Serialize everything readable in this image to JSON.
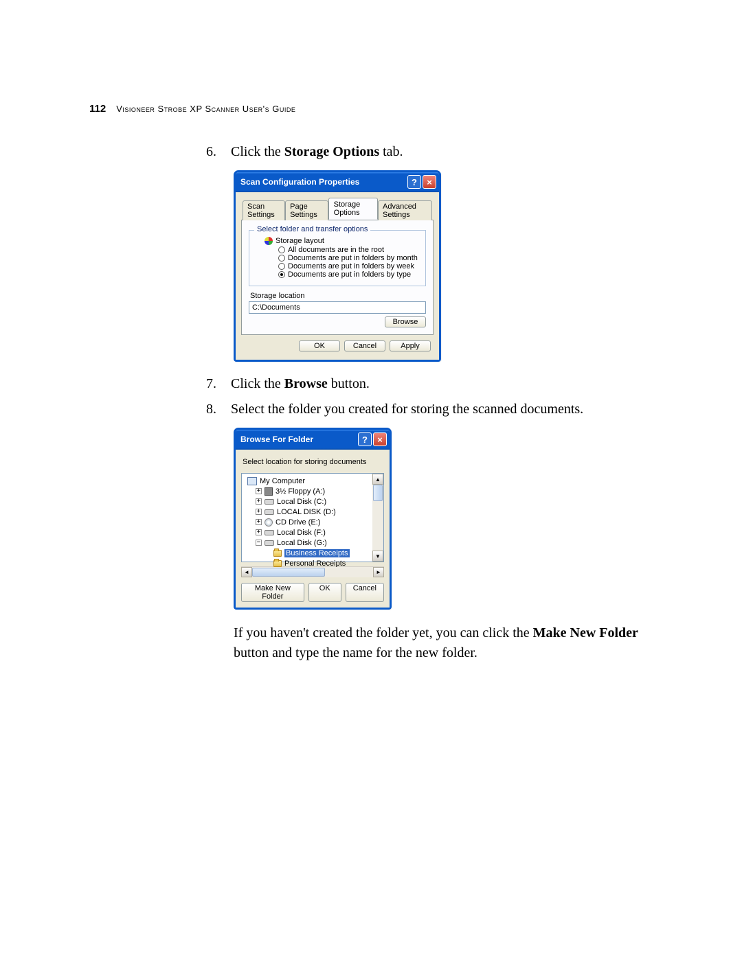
{
  "header": {
    "page_number": "112",
    "title": "Visioneer Strobe XP Scanner User's Guide"
  },
  "steps": {
    "s6_num": "6.",
    "s6_a": "Click the ",
    "s6_b": "Storage Options",
    "s6_c": " tab.",
    "s7_num": "7.",
    "s7_a": "Click the ",
    "s7_b": "Browse",
    "s7_c": " button.",
    "s8_num": "8.",
    "s8_text": "Select the folder you created for storing the scanned documents."
  },
  "paragraph": {
    "a": "If you haven't created the folder yet, you can click the ",
    "b": "Make New Folder",
    "c": " button and type the name for the new folder."
  },
  "dialog1": {
    "title": "Scan Configuration Properties",
    "tabs": {
      "scan": "Scan Settings",
      "page": "Page Settings",
      "storage": "Storage Options",
      "advanced": "Advanced Settings"
    },
    "group_title": "Select folder and transfer options",
    "storage_layout_label": "Storage layout",
    "radio1": "All documents are in the root",
    "radio2": "Documents are put in folders by month",
    "radio3": "Documents are put in folders by week",
    "radio4": "Documents are put in folders by type",
    "location_label": "Storage location",
    "location_value": "C:\\Documents",
    "browse_btn": "Browse",
    "ok": "OK",
    "cancel": "Cancel",
    "apply": "Apply"
  },
  "dialog2": {
    "title": "Browse For Folder",
    "prompt": "Select location for storing documents",
    "items": {
      "my_computer": "My Computer",
      "floppy": "3½ Floppy (A:)",
      "disk_c": "Local Disk (C:)",
      "disk_d": "LOCAL DISK (D:)",
      "cd": "CD Drive (E:)",
      "disk_f": "Local Disk (F:)",
      "disk_g": "Local Disk (G:)",
      "business": "Business Receipts",
      "personal": "Personal Receipts"
    },
    "make_new": "Make New Folder",
    "ok": "OK",
    "cancel": "Cancel"
  }
}
